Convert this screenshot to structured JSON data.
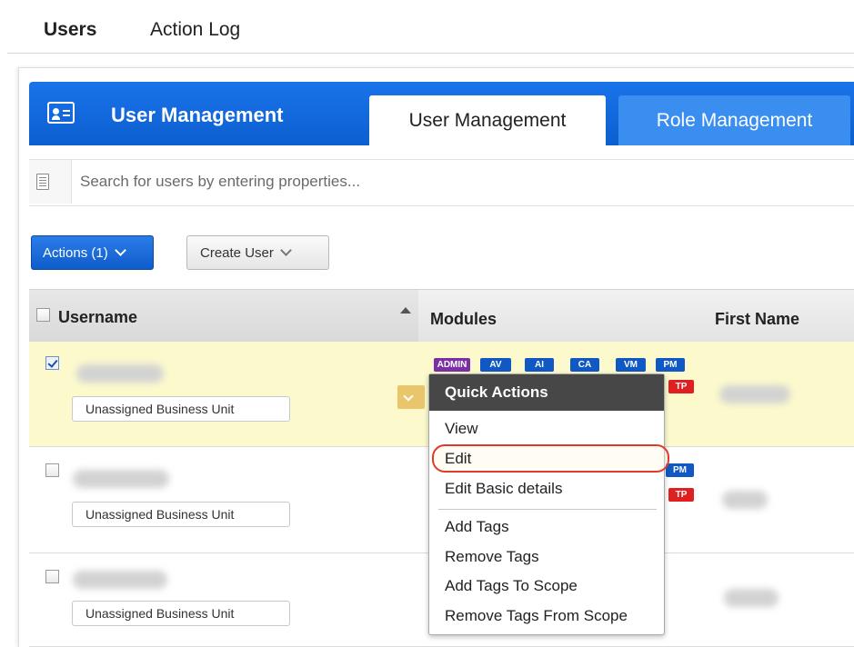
{
  "top_nav": {
    "users": "Users",
    "action_log": "Action Log"
  },
  "banner": {
    "title": "User Management",
    "icon": "user-card-icon"
  },
  "tabs": [
    {
      "label": "User Management",
      "active": true
    },
    {
      "label": "Role Management",
      "active": false
    }
  ],
  "search": {
    "placeholder": "Search for users by entering properties...",
    "value": ""
  },
  "toolbar": {
    "actions_label": "Actions (1)",
    "create_user_label": "Create User"
  },
  "table": {
    "columns": [
      "Username",
      "Modules",
      "First Name"
    ],
    "sort": {
      "column": "Username",
      "direction": "ascending"
    },
    "rows": [
      {
        "selected": true,
        "business_unit": "Unassigned Business Unit",
        "modules": [
          "ADMIN",
          "AV",
          "AI",
          "CA",
          "VM",
          "PM",
          "TP"
        ]
      },
      {
        "selected": false,
        "business_unit": "Unassigned Business Unit",
        "modules": [
          "PM",
          "TP"
        ]
      },
      {
        "selected": false,
        "business_unit": "Unassigned Business Unit",
        "modules": []
      }
    ]
  },
  "quick_actions": {
    "title": "Quick Actions",
    "items": [
      "View",
      "Edit",
      "Edit Basic details",
      "Add Tags",
      "Remove Tags",
      "Add Tags To Scope",
      "Remove Tags From Scope"
    ],
    "highlighted": "Edit"
  },
  "colors": {
    "banner": "#0c5fcf",
    "selected_row": "#fcfacd",
    "highlight_ring": "#e03a2a",
    "admin_badge": "#7b2ea6",
    "module_badge": "#1058c4",
    "tp_badge": "#e02020"
  }
}
